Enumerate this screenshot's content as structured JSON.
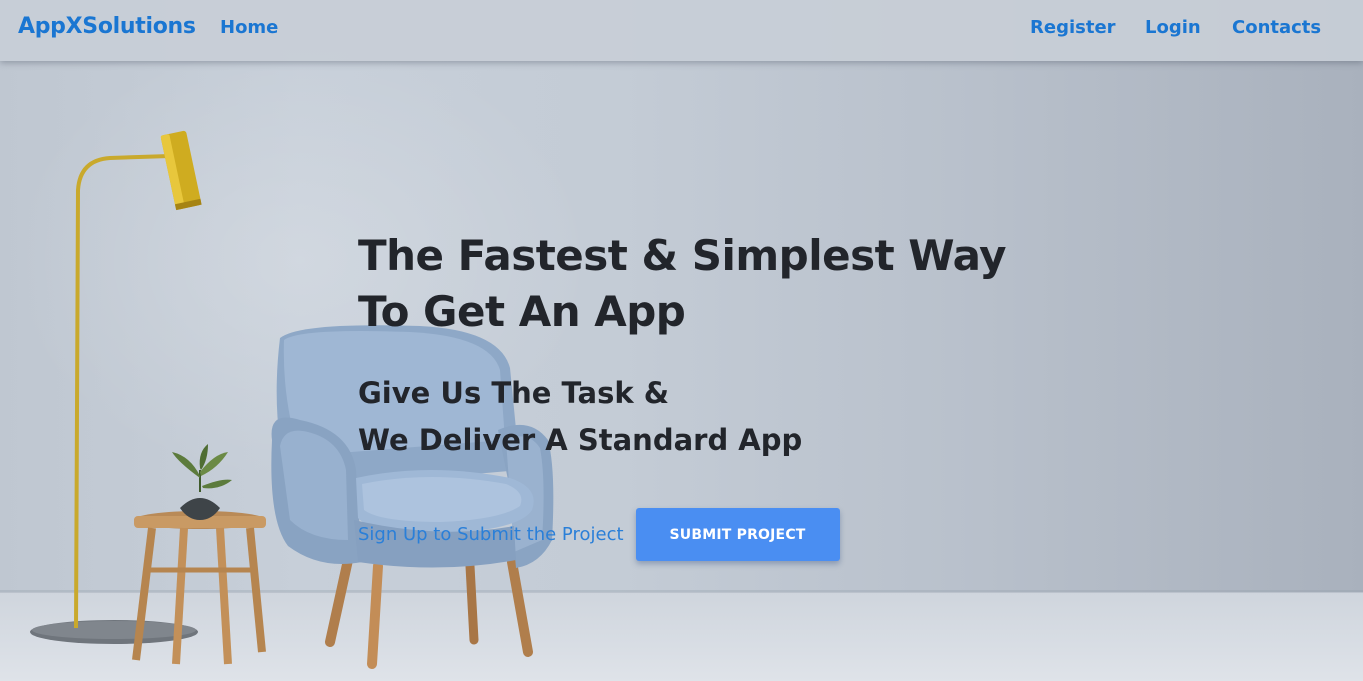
{
  "navbar": {
    "brand": "AppXSolutions",
    "home": "Home",
    "register": "Register",
    "login": "Login",
    "contacts": "Contacts"
  },
  "hero": {
    "headline": "The Fastest & Simplest Way To Get An App",
    "subhead_line1": "Give Us The Task &",
    "subhead_line2": "We Deliver A Standard App",
    "signup_link": "Sign Up to Submit the Project",
    "submit_button": "SUBMIT PROJECT"
  },
  "colors": {
    "accent": "#1a76d2",
    "button": "#4a8ef2",
    "text_dark": "#22252b"
  },
  "icons": [
    "floor-lamp-icon",
    "armchair-icon",
    "side-table-icon",
    "plant-vase-icon"
  ]
}
